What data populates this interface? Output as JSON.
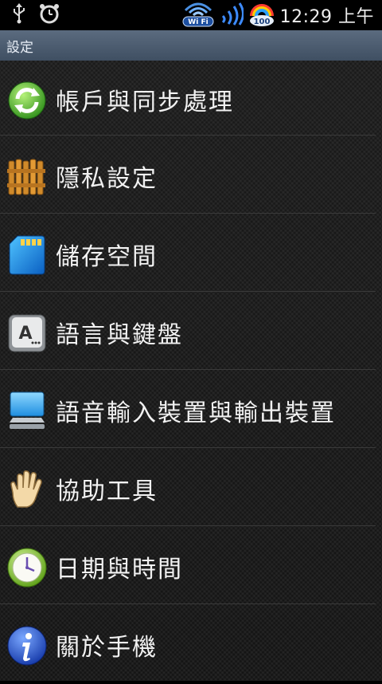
{
  "status_bar": {
    "icons": [
      "usb-icon",
      "alarm-clock-icon",
      "wifi-icon",
      "signal-icon",
      "battery-icon"
    ],
    "wifi_label": "Wi Fi",
    "battery_level": "100",
    "time": "12:29 上午"
  },
  "title_bar": {
    "title": "設定"
  },
  "settings": {
    "items": [
      {
        "label": "帳戶與同步處理",
        "icon": "sync-icon"
      },
      {
        "label": "隱私設定",
        "icon": "fence-icon"
      },
      {
        "label": "儲存空間",
        "icon": "sd-card-icon"
      },
      {
        "label": "語言與鍵盤",
        "icon": "keyboard-key-icon"
      },
      {
        "label": "語音輸入裝置與輸出裝置",
        "icon": "monitor-icon"
      },
      {
        "label": "協助工具",
        "icon": "hand-icon"
      },
      {
        "label": "日期與時間",
        "icon": "clock-icon"
      },
      {
        "label": "關於手機",
        "icon": "info-icon"
      }
    ]
  }
}
